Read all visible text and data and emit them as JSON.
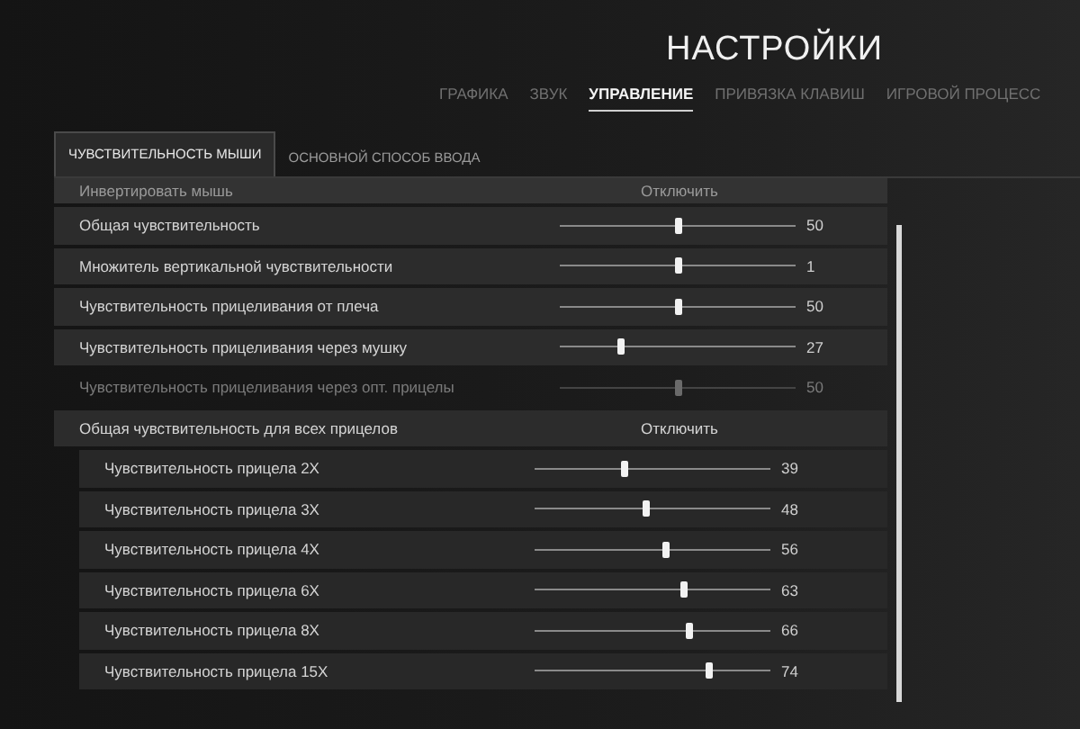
{
  "header": {
    "title": "НАСТРОЙКИ"
  },
  "tabs": [
    {
      "label": "ГРАФИКА",
      "selected": false
    },
    {
      "label": "ЗВУК",
      "selected": false
    },
    {
      "label": "УПРАВЛЕНИЕ",
      "selected": true
    },
    {
      "label": "ПРИВЯЗКА КЛАВИШ",
      "selected": false
    },
    {
      "label": "ИГРОВОЙ ПРОЦЕСС",
      "selected": false
    }
  ],
  "subtabs": [
    {
      "label": "ЧУВСТВИТЕЛЬНОСТЬ МЫШИ",
      "selected": true
    },
    {
      "label": "ОСНОВНОЙ СПОСОБ ВВОДА",
      "selected": false
    }
  ],
  "settings": [
    {
      "kind": "toggle",
      "label": "Инвертировать мышь",
      "value": "Отключить",
      "disabled": false
    },
    {
      "kind": "slider",
      "label": "Общая чувствительность",
      "level": 0.5,
      "reading": "50",
      "disabled": false
    },
    {
      "kind": "slider",
      "label": "Множитель вертикальной чувствительности",
      "level": 0.5,
      "reading": "1",
      "disabled": false
    },
    {
      "kind": "slider",
      "label": "Чувствительность прицеливания от плеча",
      "level": 0.5,
      "reading": "50",
      "disabled": false
    },
    {
      "kind": "slider",
      "label": "Чувствительность прицеливания через мушку",
      "level": 0.26,
      "reading": "27",
      "disabled": false
    },
    {
      "kind": "slider",
      "label": "Чувствительность прицеливания через опт. прицелы",
      "level": 0.5,
      "reading": "50",
      "disabled": true
    },
    {
      "kind": "toggle",
      "label": "Общая чувствительность для всех прицелов",
      "value": "Отключить",
      "disabled": false,
      "children": [
        {
          "kind": "slider",
          "label": "Чувствительность прицела 2X",
          "level": 0.38,
          "reading": "39",
          "disabled": false
        },
        {
          "kind": "slider",
          "label": "Чувствительность прицела 3X",
          "level": 0.47,
          "reading": "48",
          "disabled": false
        },
        {
          "kind": "slider",
          "label": "Чувствительность прицела 4X",
          "level": 0.56,
          "reading": "56",
          "disabled": false
        },
        {
          "kind": "slider",
          "label": "Чувствительность прицела 6X",
          "level": 0.63,
          "reading": "63",
          "disabled": false
        },
        {
          "kind": "slider",
          "label": "Чувствительность прицела 8X",
          "level": 0.66,
          "reading": "66",
          "disabled": false
        },
        {
          "kind": "slider",
          "label": "Чувствительность прицела 15X",
          "level": 0.74,
          "reading": "74",
          "disabled": false
        }
      ]
    }
  ]
}
